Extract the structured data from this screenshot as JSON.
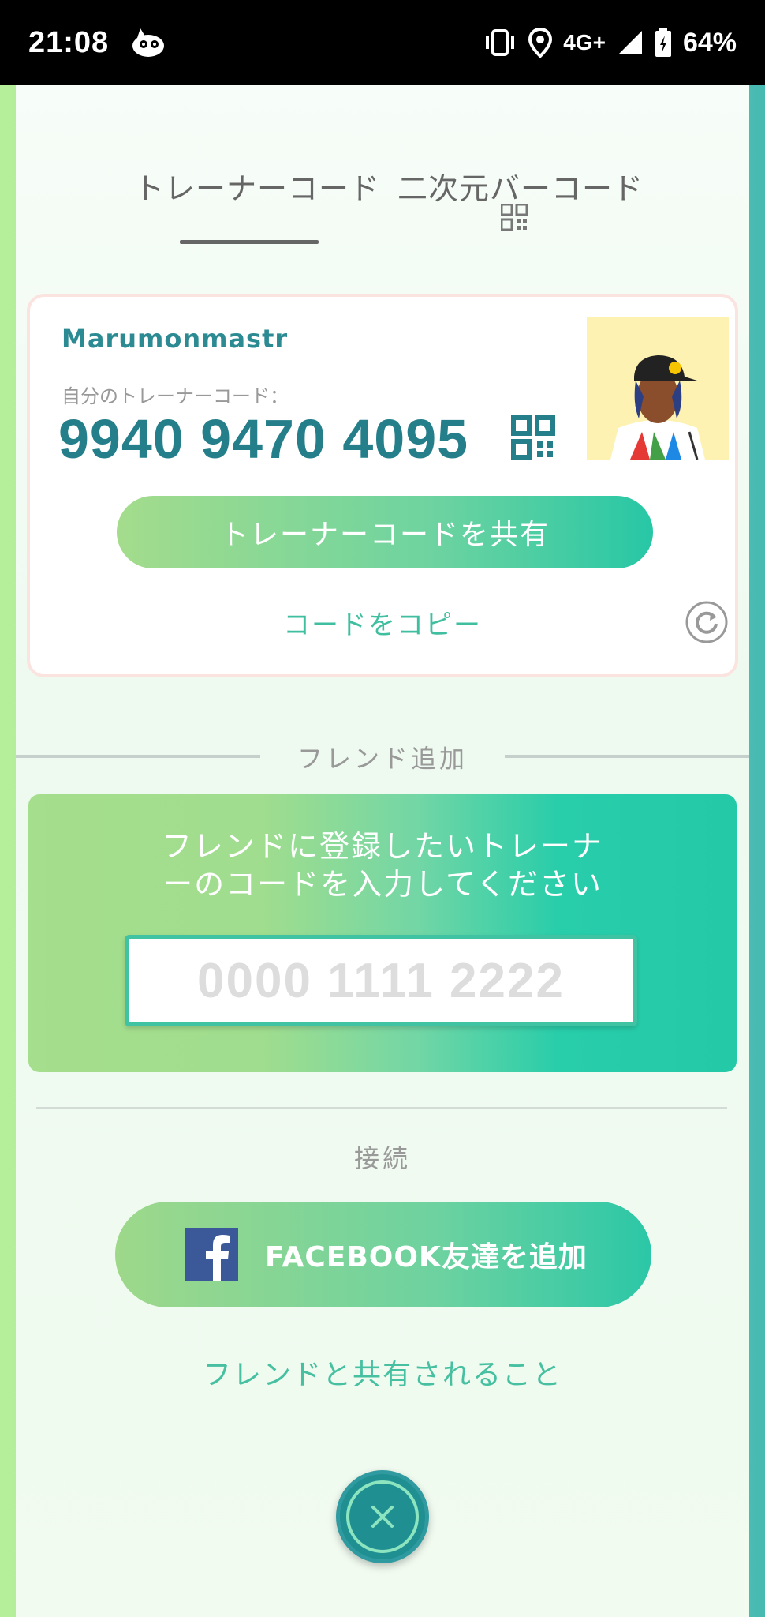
{
  "status_bar": {
    "time": "21:08",
    "network": "4G+",
    "battery": "64%",
    "icons": [
      "vibrate-icon",
      "location-icon",
      "signal-icon",
      "battery-icon"
    ]
  },
  "tabs": [
    {
      "label": "トレーナーコード",
      "active": true
    },
    {
      "label": "二次元バーコード",
      "active": false
    }
  ],
  "trainer_card": {
    "name": "Marumonmastr",
    "code_label": "自分のトレーナーコード：",
    "code": "9940 9470 4095",
    "share_label": "トレーナーコードを共有",
    "copy_label": "コードをコピー"
  },
  "friend_add": {
    "divider_label": "フレンド追加",
    "prompt_line1": "フレンドに登録したいトレーナ",
    "prompt_line2": "ーのコードを入力してください",
    "input_placeholder": "0000 1111 2222",
    "input_value": ""
  },
  "connect": {
    "label": "接続",
    "facebook_label": "FACEBOOK友達を追加",
    "share_info_label": "フレンドと共有されること"
  },
  "colors": {
    "accent": "#40bfa0",
    "code_color": "#247f8a",
    "close_button": "#1f8f92",
    "facebook": "#3b5998"
  }
}
